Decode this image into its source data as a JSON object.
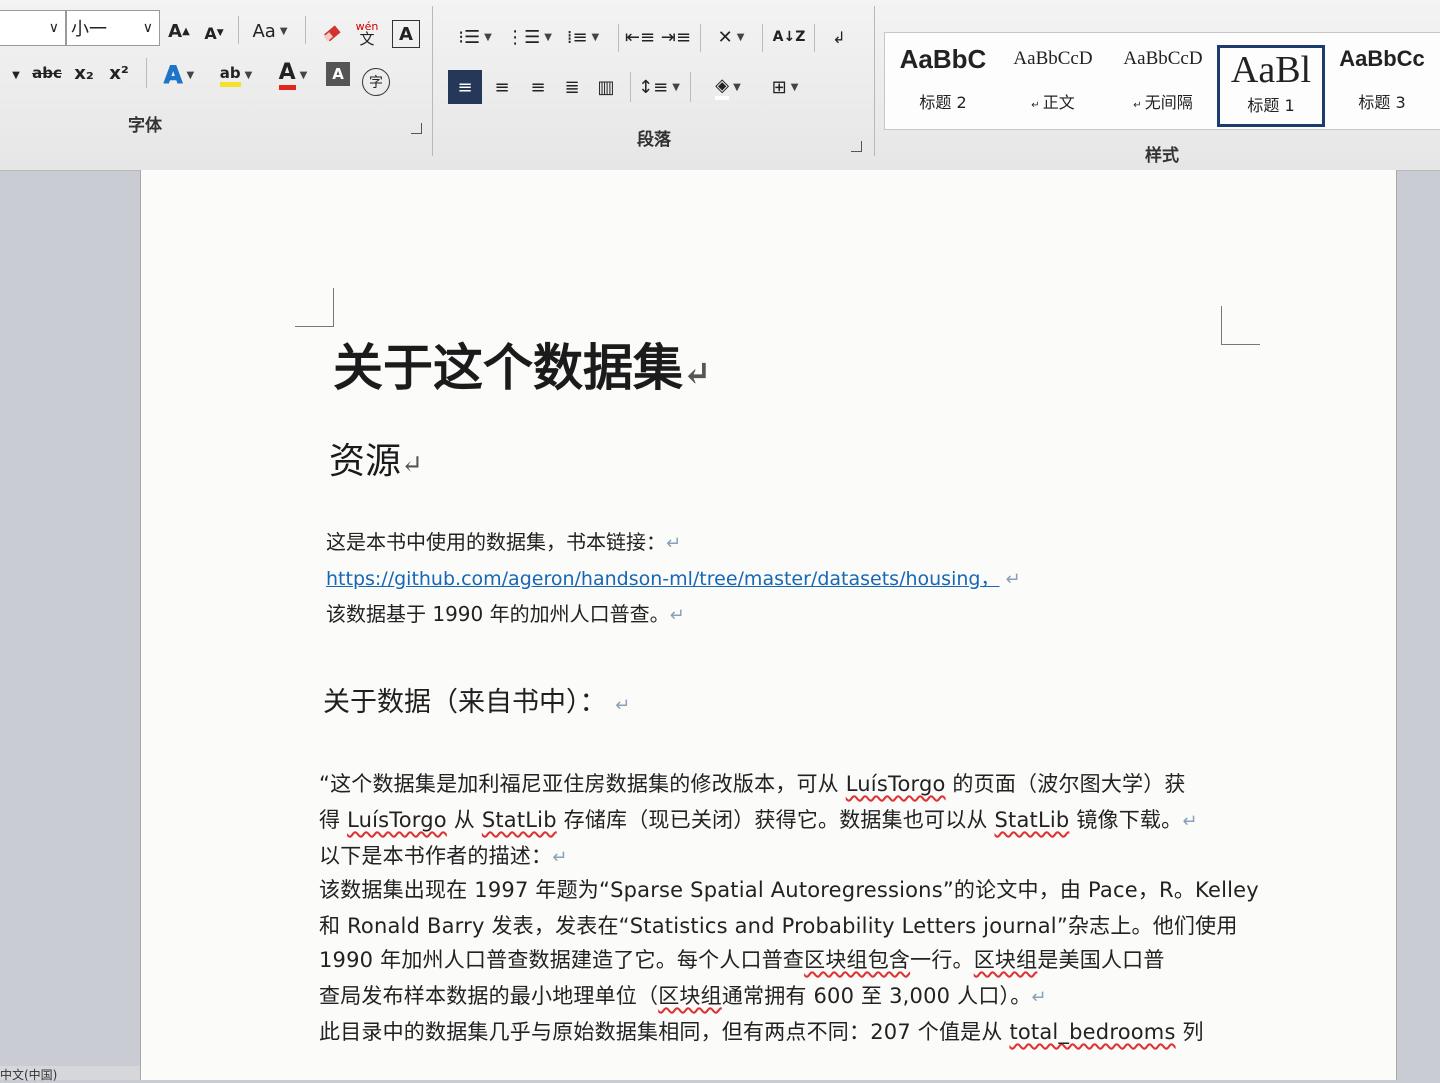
{
  "ribbon": {
    "font_size_value": "小一",
    "font_group_label": "字体",
    "paragraph_group_label": "段落",
    "styles_group_label": "样式",
    "btn_grow_font": "A",
    "btn_shrink_font": "A",
    "btn_change_case": "Aa",
    "btn_phonetic_top": "wén",
    "btn_phonetic_bottom": "文",
    "btn_char_border": "A",
    "btn_strikethrough": "abc",
    "btn_subscript": "x₂",
    "btn_superscript": "x²",
    "btn_text_effects": "A",
    "btn_highlight": "ab",
    "btn_font_color": "A",
    "btn_char_shading": "A",
    "btn_enclose_char": "字",
    "btn_sort": "A↓Z",
    "styles": [
      {
        "sample": "AaBbC",
        "name": "标题 2"
      },
      {
        "sample": "AaBbCcD",
        "name": "正文"
      },
      {
        "sample": "AaBbCcD",
        "name": "无间隔"
      },
      {
        "sample": "AaBl",
        "name": "标题 1"
      },
      {
        "sample": "AaBbCc",
        "name": "标题 3"
      }
    ]
  },
  "doc": {
    "title": "关于这个数据集",
    "section": "资源",
    "para1_line1": "这是本书中使用的数据集，书本链接：",
    "para1_link": "https://github.com/ageron/handson-ml/tree/master/datasets/housing，",
    "para1_line3": "该数据基于 1990 年的加州人口普查。",
    "subheading": "关于数据（来自书中）：",
    "body": {
      "l1_a": "“这个数据集是加利福尼亚住房数据集的修改版本，可从 ",
      "l1_b": "LuísTorgo",
      "l1_c": " 的页面（波尔图大学）获",
      "l2_a": "得 ",
      "l2_b": "LuísTorgo",
      "l2_c": " 从 ",
      "l2_d": "StatLib",
      "l2_e": " 存储库（现已关闭）获得它。数据集也可以从 ",
      "l2_f": "StatLib",
      "l2_g": " 镜像下载。",
      "l3": "以下是本书作者的描述：",
      "l4": "该数据集出现在 1997 年题为“Sparse Spatial Autoregressions”的论文中，由 Pace，R。Kelley",
      "l5": "和 Ronald Barry 发表，发表在“Statistics and Probability Letters journal”杂志上。他们使用",
      "l6_a": "1990 年加州人口普查数据建造了它。每个人口普查",
      "l6_b": "区块组包含",
      "l6_c": "一行。",
      "l6_d": "区块组",
      "l6_e": "是美国人口普",
      "l7_a": "查局发布样本数据的最小地理单位（",
      "l7_b": "区块组",
      "l7_c": "通常拥有 600 至 3,000 人口）。",
      "l8_a": "此目录中的数据集几乎与原始数据集相同，但有两点不同：207 个值是从 ",
      "l8_b": "total_bedrooms",
      "l8_c": " 列"
    },
    "para_mark": "↵"
  },
  "status": {
    "language": "中文(中国)"
  }
}
